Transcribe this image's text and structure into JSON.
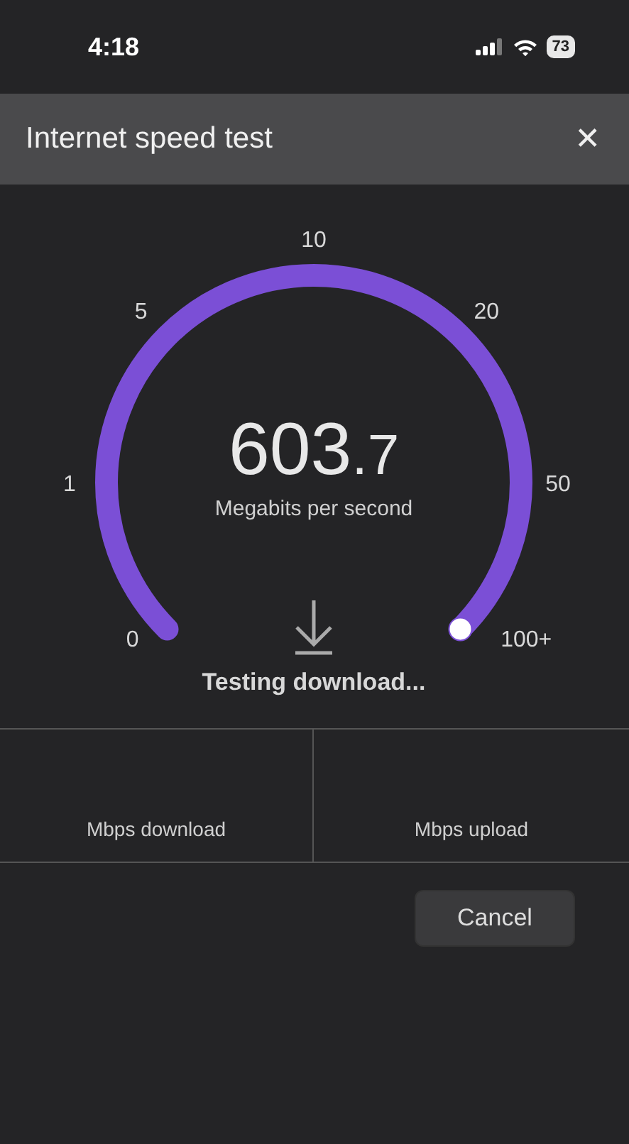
{
  "status_bar": {
    "time": "4:18",
    "battery": "73"
  },
  "header": {
    "title": "Internet speed test",
    "close": "✕"
  },
  "gauge": {
    "ticks": [
      "0",
      "1",
      "5",
      "10",
      "20",
      "50",
      "100+"
    ],
    "reading_whole": "603",
    "reading_fraction": ".7",
    "unit": "Megabits per second",
    "status": "Testing download..."
  },
  "results": [
    {
      "label": "Mbps download"
    },
    {
      "label": "Mbps upload"
    }
  ],
  "buttons": [
    {
      "label": "Cancel"
    }
  ]
}
